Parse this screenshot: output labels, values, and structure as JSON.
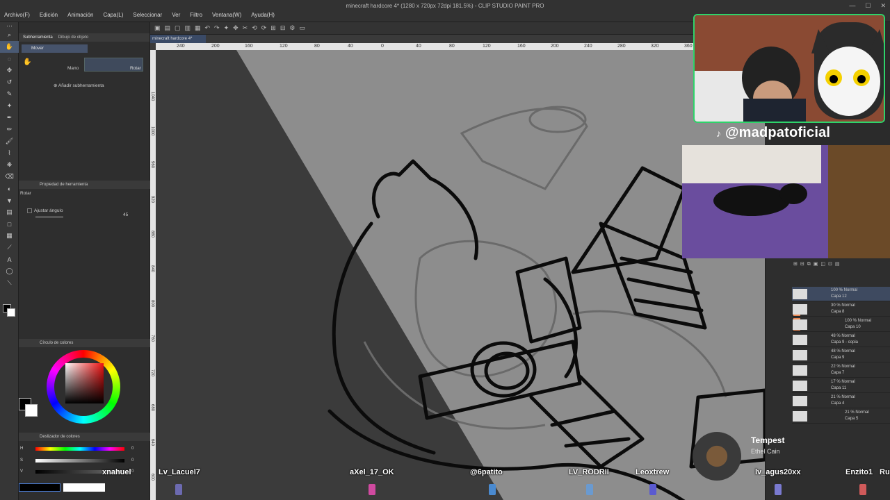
{
  "window": {
    "title": "minecraft hardcore 4* (1280 x 720px 72dpi 181.5%) - CLIP STUDIO PAINT PRO",
    "controls": [
      "—",
      "☐",
      "✕"
    ]
  },
  "menu": [
    "Archivo(F)",
    "Edición",
    "Animación",
    "Capa(L)",
    "Seleccionar",
    "Ver",
    "Filtro",
    "Ventana(W)",
    "Ayuda(H)"
  ],
  "left_panel": {
    "tab_active": "Subherramienta",
    "tab_other": "Dibujo de objeto",
    "sub_tool": "Mover",
    "mano": "Mano",
    "rotar": "Rotar",
    "add_subtool": "Añadir subherramienta",
    "prop_title": "Propiedad de herramienta",
    "prop_tool": "Rotar",
    "ajustar": "Ajustar ángulo",
    "angle": "45",
    "color_circle_title": "Círculo de colores",
    "color_slider_title": "Deslizador de colores",
    "h_label": "H",
    "s_label": "S",
    "v_label": "V",
    "h_val": "0",
    "s_val": "0",
    "v_val": "0",
    "rgb_vals": [
      "0",
      "0",
      "0"
    ]
  },
  "canvas": {
    "doc_tab": "minecraft hardcore 4*",
    "ruler_h": [
      "240",
      "200",
      "160",
      "120",
      "80",
      "40",
      "0",
      "40",
      "80",
      "120",
      "160",
      "200",
      "240",
      "280",
      "320",
      "360"
    ],
    "ruler_v": [
      "1040",
      "1000",
      "960",
      "920",
      "880",
      "840",
      "800",
      "760",
      "720",
      "680",
      "640",
      "600"
    ]
  },
  "stream": {
    "handle": "@madpatoficial",
    "song_title": "Tempest",
    "song_artist": "Ethel Cain",
    "viewers": [
      "xnahuel",
      "Lv_Lacuel7",
      "aXel_17_OK",
      "@6patito",
      "LV_RODRII",
      "Leoxtrew",
      "lv_agus20xx",
      "Enzito1",
      "Ru"
    ]
  },
  "layers": [
    {
      "opacity_mode": "100 % Normal",
      "name": "Capa 12",
      "selected": true
    },
    {
      "opacity_mode": "30 % Normal",
      "name": "Capa 8",
      "selected": false
    },
    {
      "opacity_mode": "100 % Normal",
      "name": "Capa 10",
      "selected": false
    },
    {
      "opacity_mode": "48 % Normal",
      "name": "Capa 9 - copia",
      "selected": false
    },
    {
      "opacity_mode": "48 % Normal",
      "name": "Capa 9",
      "selected": false
    },
    {
      "opacity_mode": "22 % Normal",
      "name": "Capa 7",
      "selected": false
    },
    {
      "opacity_mode": "17 % Normal",
      "name": "Capa 11",
      "selected": false
    },
    {
      "opacity_mode": "21 % Normal",
      "name": "Capa 4",
      "selected": false
    },
    {
      "opacity_mode": "21 % Normal",
      "name": "Capa 5",
      "selected": false
    }
  ],
  "colors": {
    "cam_border": "#2ed36a",
    "selection": "#3e4a60",
    "layer_visibility": "#e88550"
  },
  "icons": [
    "hand-icon",
    "move-icon",
    "zoom-icon",
    "pen-icon",
    "brush-icon",
    "eraser-icon",
    "fill-icon",
    "text-icon",
    "tiktok-icon"
  ]
}
